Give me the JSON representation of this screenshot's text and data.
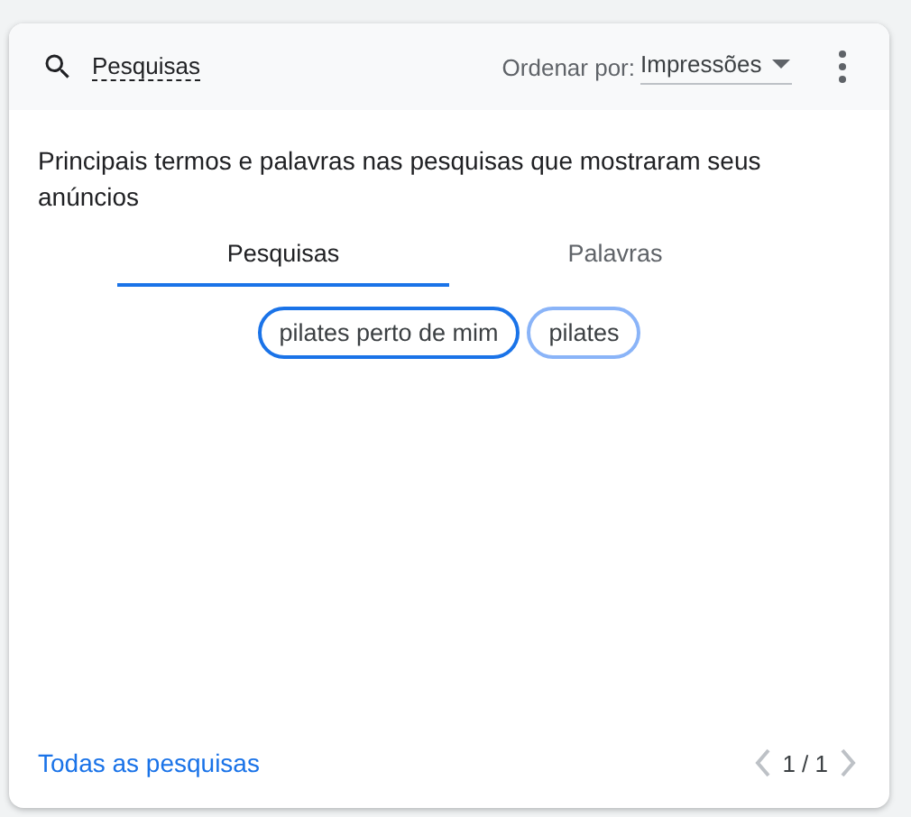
{
  "header": {
    "search_label": "Pesquisas",
    "sort_label": "Ordenar por:",
    "sort_value": "Impressões"
  },
  "description": "Principais termos e palavras nas pesquisas que mostraram seus anúncios",
  "tabs": [
    {
      "label": "Pesquisas",
      "selected": true
    },
    {
      "label": "Palavras",
      "selected": false
    }
  ],
  "chips": [
    {
      "label": "pilates perto de mim",
      "color": "#1a73e8"
    },
    {
      "label": "pilates",
      "color": "#8ab4f8"
    }
  ],
  "footer": {
    "link": "Todas as pesquisas",
    "page": "1 / 1",
    "prev_disabled": true,
    "next_disabled": true
  }
}
